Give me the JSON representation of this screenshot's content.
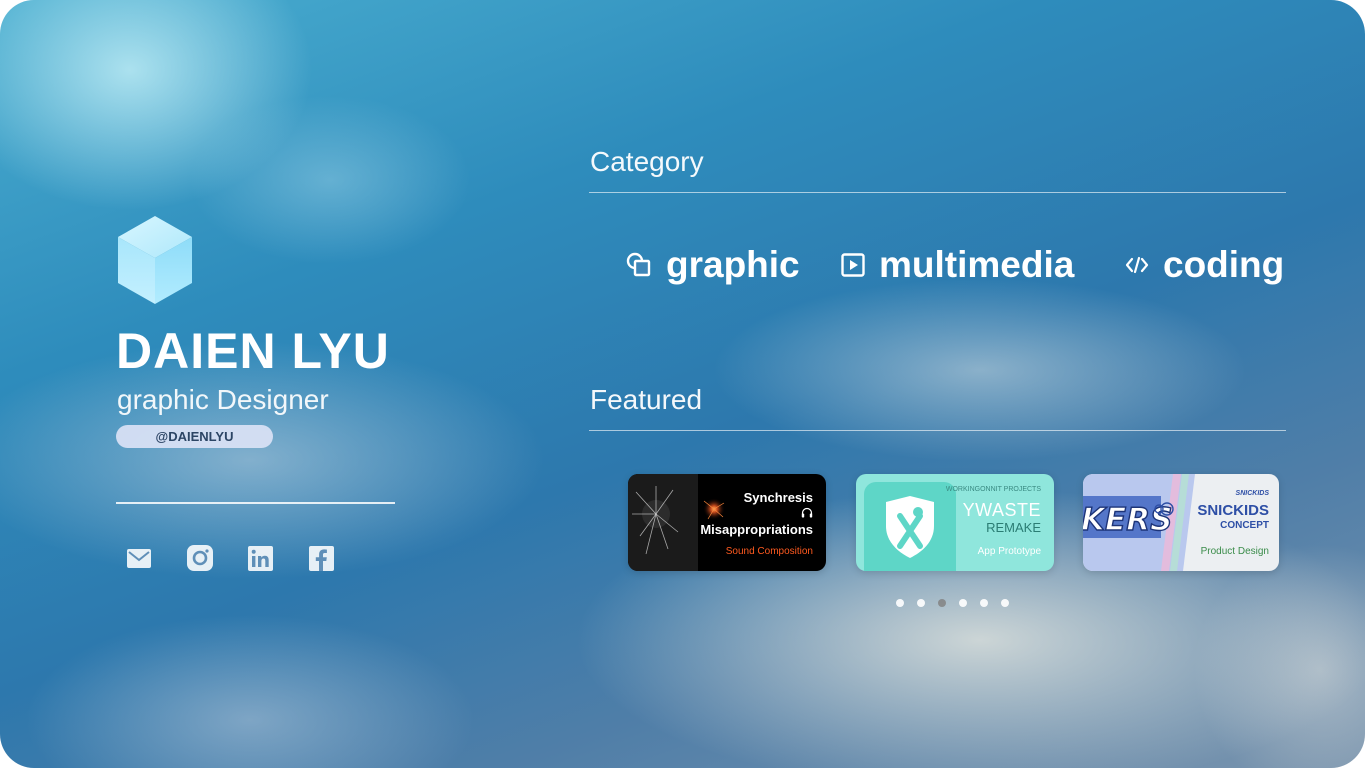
{
  "profile": {
    "name": "DAIEN LYU",
    "role": "graphic Designer",
    "handle": "@DAIENLYU",
    "social_icons": [
      "mail-icon",
      "instagram-icon",
      "linkedin-icon",
      "facebook-icon"
    ]
  },
  "category": {
    "title": "Category",
    "items": [
      {
        "label": "graphic",
        "icon": "shapes-icon"
      },
      {
        "label": "multimedia",
        "icon": "play-icon"
      },
      {
        "label": "coding",
        "icon": "code-icon"
      }
    ]
  },
  "featured": {
    "title": "Featured",
    "cards": [
      {
        "title_line1": "Synchresis",
        "title_line2": "Misappropriations",
        "subtitle": "Sound Composition"
      },
      {
        "kicker": "WORKINGONNIT PROJECTS",
        "title_line1": "YWASTE",
        "title_line2": "REMAKE",
        "subtitle": "App Prototype"
      },
      {
        "brand": "SNICKIDS",
        "art_text": "KERS",
        "title_line1": "SNICKIDS",
        "title_line2": "CONCEPT",
        "subtitle": "Product Design"
      }
    ],
    "pagination": {
      "total": 6,
      "active_index": 2
    }
  },
  "colors": {
    "accent_orange": "#ff5a1f",
    "teal": "#8fe6dc",
    "handle_bg": "#dae2f5"
  }
}
